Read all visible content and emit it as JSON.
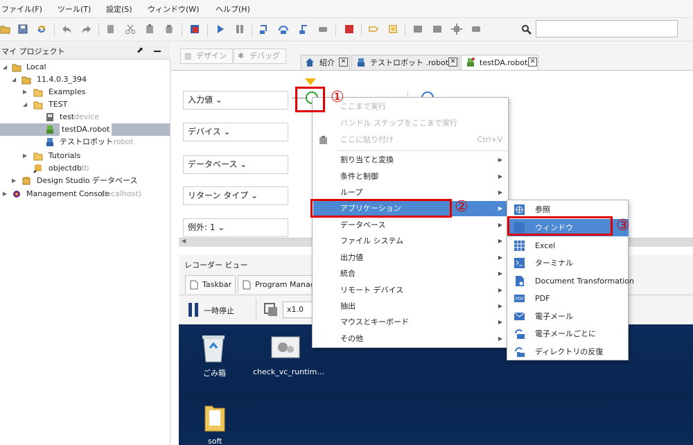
{
  "menubar": {
    "items": [
      "ファイル(F)",
      "ツール(T)",
      "設定(S)",
      "ウィンドウ(W)",
      "ヘルプ(H)"
    ]
  },
  "toolbar": {
    "icons": [
      "open-folder-icon",
      "save-all-icon",
      "refresh-icon",
      "undo-icon",
      "redo-icon",
      "copy-icon",
      "cut-icon",
      "paste-icon",
      "paste-special-icon",
      "debug-icon",
      "play-icon",
      "pause-icon",
      "step-into-icon",
      "step-over-icon",
      "step-out-icon",
      "run-to-icon",
      "stop-icon",
      "breakpoint-icon",
      "bulb-icon",
      "grid-icon",
      "grid2-icon",
      "move-icon",
      "plugin-icon",
      "search-icon"
    ],
    "search_value": ""
  },
  "project_panel": {
    "title": "マイ プロジェクト",
    "tree": [
      {
        "label": "Local",
        "suffix": ""
      },
      {
        "label": "11.4.0.3_394",
        "suffix": ""
      },
      {
        "label": "Examples",
        "suffix": ""
      },
      {
        "label": "TEST",
        "suffix": ""
      },
      {
        "label": "test",
        "suffix": " device"
      },
      {
        "label": "testDA.robot",
        "suffix": ""
      },
      {
        "label": "テストロボット",
        "suffix": " .robot"
      },
      {
        "label": "Tutorials",
        "suffix": ""
      },
      {
        "label": "objectdb",
        "suffix": " .db"
      },
      {
        "label": "Design Studio データベース",
        "suffix": ""
      },
      {
        "label": "Management Console",
        "suffix": " (localhost)"
      }
    ]
  },
  "mode_buttons": {
    "design": "デザイン",
    "debug": "デバッグ"
  },
  "tabs": [
    {
      "label": "紹介"
    },
    {
      "label": "テストロボット .robot"
    },
    {
      "label": "testDA.robot"
    }
  ],
  "editor_fields": [
    {
      "label": "入力値 ⌄"
    },
    {
      "label": "デバイス ⌄"
    },
    {
      "label": "データベース ⌄"
    },
    {
      "label": "リターン タイプ ⌄"
    },
    {
      "label": "例外: 1 ⌄"
    }
  ],
  "recorder": {
    "title": "レコーダー ビュー",
    "tabs": [
      "Taskbar",
      "Program Manager"
    ],
    "pause_label": "一時停止",
    "speed_value": "x1.0",
    "desktop_icons": [
      {
        "label": "ごみ箱"
      },
      {
        "label": "check_vc_runtim..."
      },
      {
        "label": "soft"
      }
    ]
  },
  "context_menu": {
    "items": [
      {
        "label": "ここまで実行",
        "disabled": true,
        "submenu": false,
        "shortcut": ""
      },
      {
        "label": "バンドル ステップをここまで実行",
        "disabled": true,
        "submenu": false,
        "shortcut": ""
      },
      {
        "label": "ここに貼り付け",
        "disabled": true,
        "submenu": false,
        "shortcut": "Ctrl+V"
      },
      {
        "label": "割り当てと変換",
        "disabled": false,
        "submenu": true,
        "shortcut": ""
      },
      {
        "label": "条件と制御",
        "disabled": false,
        "submenu": true,
        "shortcut": ""
      },
      {
        "label": "ループ",
        "disabled": false,
        "submenu": true,
        "shortcut": ""
      },
      {
        "label": "アプリケーション",
        "disabled": false,
        "submenu": true,
        "shortcut": "",
        "highlighted": true
      },
      {
        "label": "データベース",
        "disabled": false,
        "submenu": true,
        "shortcut": ""
      },
      {
        "label": "ファイル システム",
        "disabled": false,
        "submenu": true,
        "shortcut": ""
      },
      {
        "label": "出力値",
        "disabled": false,
        "submenu": true,
        "shortcut": ""
      },
      {
        "label": "統合",
        "disabled": false,
        "submenu": true,
        "shortcut": ""
      },
      {
        "label": "リモート デバイス",
        "disabled": false,
        "submenu": true,
        "shortcut": ""
      },
      {
        "label": "抽出",
        "disabled": false,
        "submenu": true,
        "shortcut": ""
      },
      {
        "label": "マウスとキーボード",
        "disabled": false,
        "submenu": true,
        "shortcut": ""
      },
      {
        "label": "その他",
        "disabled": false,
        "submenu": true,
        "shortcut": ""
      }
    ]
  },
  "submenu": {
    "items": [
      {
        "label": "参照",
        "icon": "globe-icon"
      },
      {
        "label": "ウィンドウ",
        "icon": "window-icon",
        "highlighted": true
      },
      {
        "label": "Excel",
        "icon": "excel-icon"
      },
      {
        "label": "ターミナル",
        "icon": "terminal-icon"
      },
      {
        "label": "Document Transformation",
        "icon": "document-transform-icon"
      },
      {
        "label": "PDF",
        "icon": "pdf-icon"
      },
      {
        "label": "電子メール",
        "icon": "email-icon"
      },
      {
        "label": "電子メールごとに",
        "icon": "email-loop-icon"
      },
      {
        "label": "ディレクトリの反復",
        "icon": "directory-loop-icon"
      }
    ]
  },
  "annotations": {
    "step1": "①",
    "step2": "②",
    "step3": "③"
  },
  "colors": {
    "highlight": "#4c89d2",
    "annotation": "#e10000",
    "selected_row": "#b1b9c7",
    "desktop": "#0c2b5a"
  }
}
